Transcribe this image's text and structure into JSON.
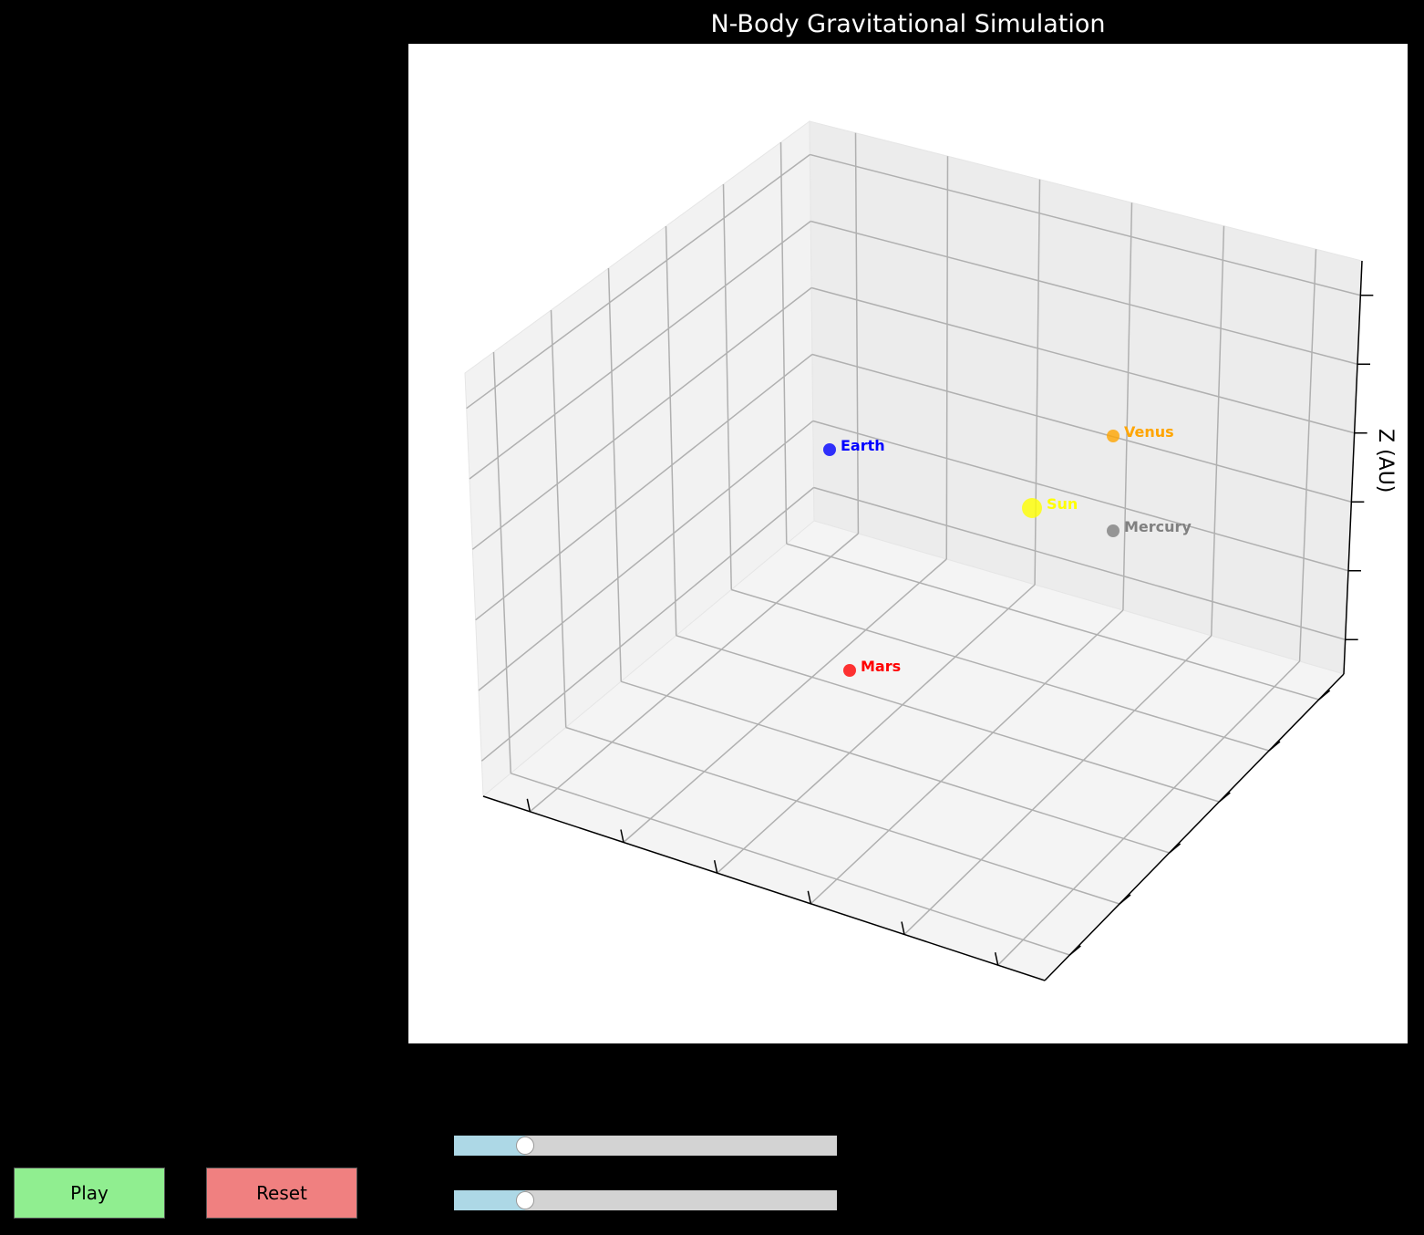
{
  "title": "N-Body Gravitational Simulation",
  "axes": {
    "zlabel": "Z (AU)"
  },
  "bodies": [
    {
      "name": "Sun",
      "color": "#ffff00",
      "label_color": "#ffff00"
    },
    {
      "name": "Venus",
      "color": "#ffa500",
      "label_color": "#ffa500"
    },
    {
      "name": "Earth",
      "color": "#0000ff",
      "label_color": "#0000ff"
    },
    {
      "name": "Mercury",
      "color": "#808080",
      "label_color": "#808080"
    },
    {
      "name": "Mars",
      "color": "#ff0000",
      "label_color": "#ff0000"
    }
  ],
  "controls": {
    "play_label": "Play",
    "play_color": "#90ee90",
    "reset_label": "Reset",
    "reset_color": "#f08080",
    "sliders": [
      {
        "value_fraction": 0.185,
        "fill_color": "#add8e6",
        "track_color": "#d3d3d3"
      },
      {
        "value_fraction": 0.185,
        "fill_color": "#add8e6",
        "track_color": "#d3d3d3"
      }
    ]
  }
}
